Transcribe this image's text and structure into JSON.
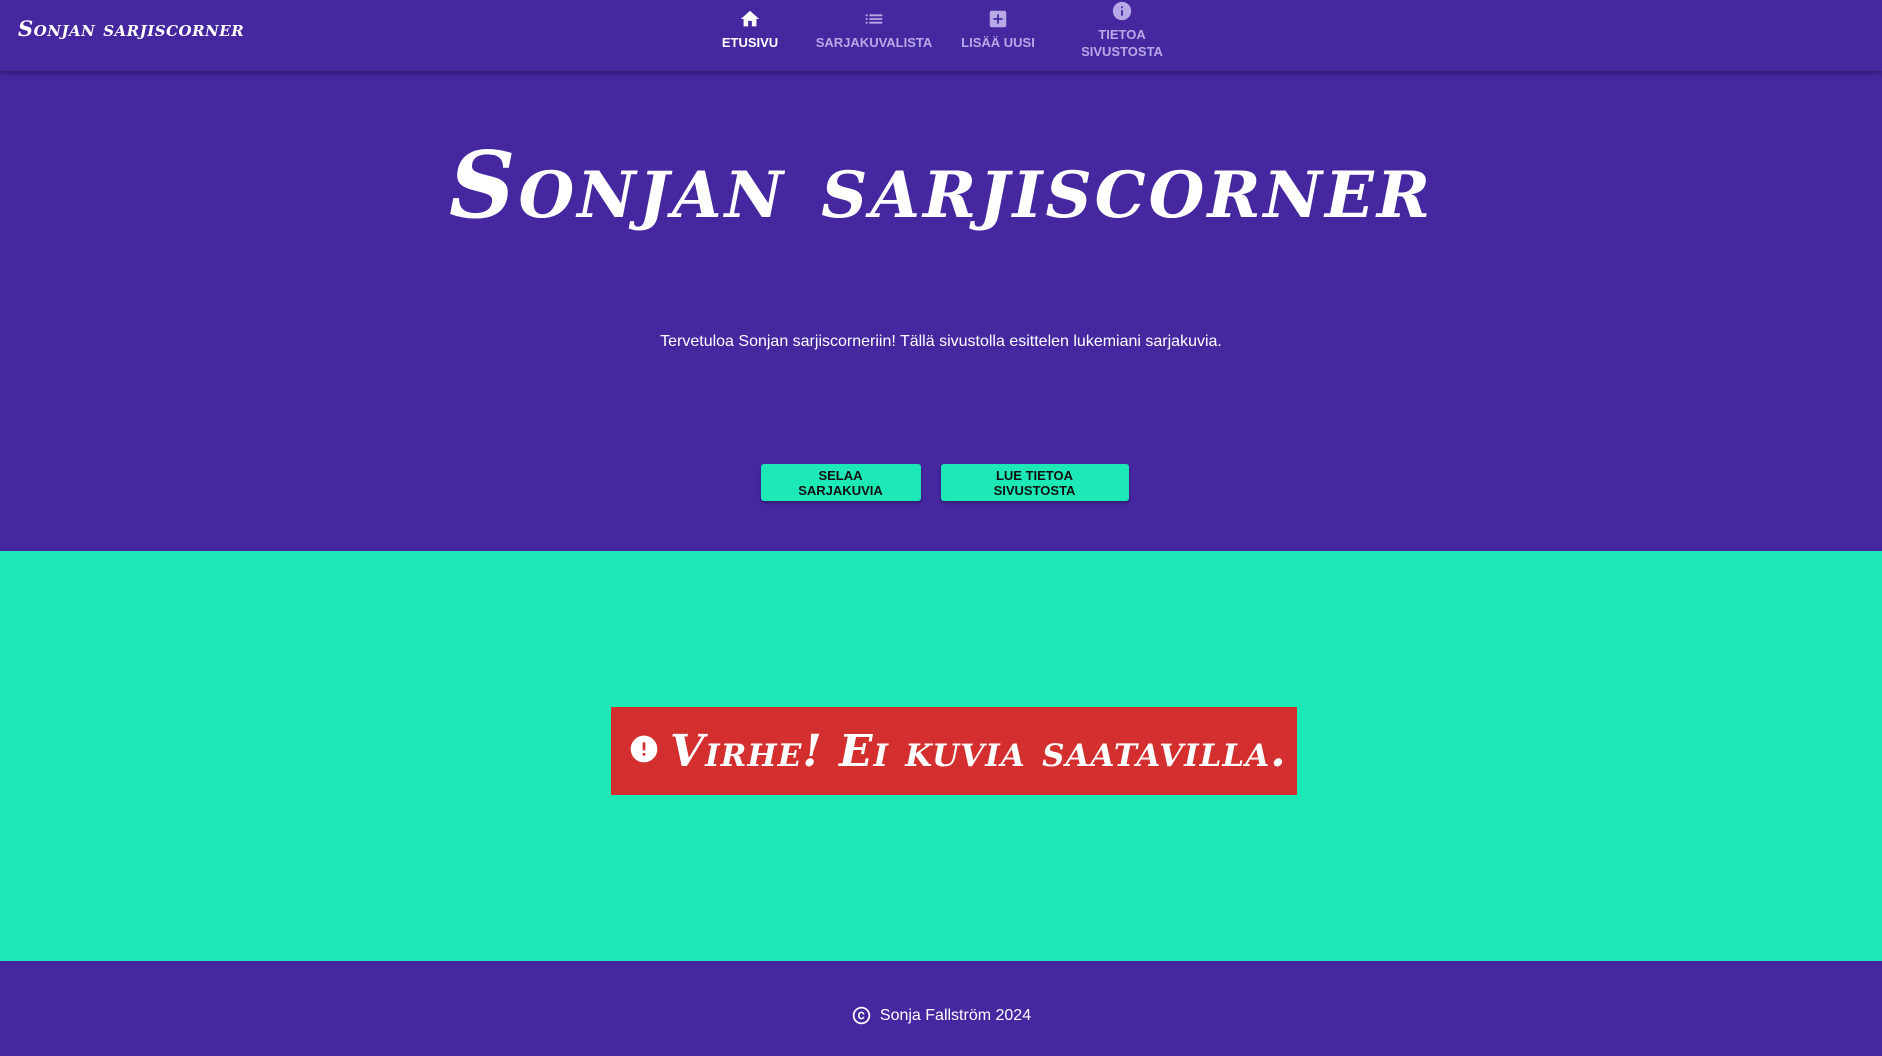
{
  "app": {
    "brand": "Sonjan sarjiscorner"
  },
  "nav": {
    "items": [
      {
        "label": "ETUSIVU",
        "icon": "home-icon",
        "active": true
      },
      {
        "label": "SARJAKUVALISTA",
        "icon": "list-icon",
        "active": false
      },
      {
        "label": "LISÄÄ UUSI",
        "icon": "add-box-icon",
        "active": false
      },
      {
        "label_line1": "TIETOA",
        "label_line2": "SIVUSTOSTA",
        "icon": "info-icon",
        "active": false
      }
    ]
  },
  "hero": {
    "title": "Sonjan sarjiscorner",
    "welcome": "Tervetuloa Sonjan sarjiscorneriin! Tällä sivustolla esittelen lukemiani sarjakuvia.",
    "buttons": {
      "browse": "SELAA SARJAKUVIA",
      "about": "LUE TIETOA SIVUSTOSTA"
    }
  },
  "error": {
    "icon": "error-icon",
    "message": "Virhe! Ei kuvia saatavilla."
  },
  "footer": {
    "icon": "copyright-icon",
    "text": "Sonja Fallström 2024"
  },
  "colors": {
    "primary": "#4527a0",
    "accent": "#1de9b6",
    "error": "#d32f2f",
    "nav_inactive": "#b7a9e6"
  }
}
